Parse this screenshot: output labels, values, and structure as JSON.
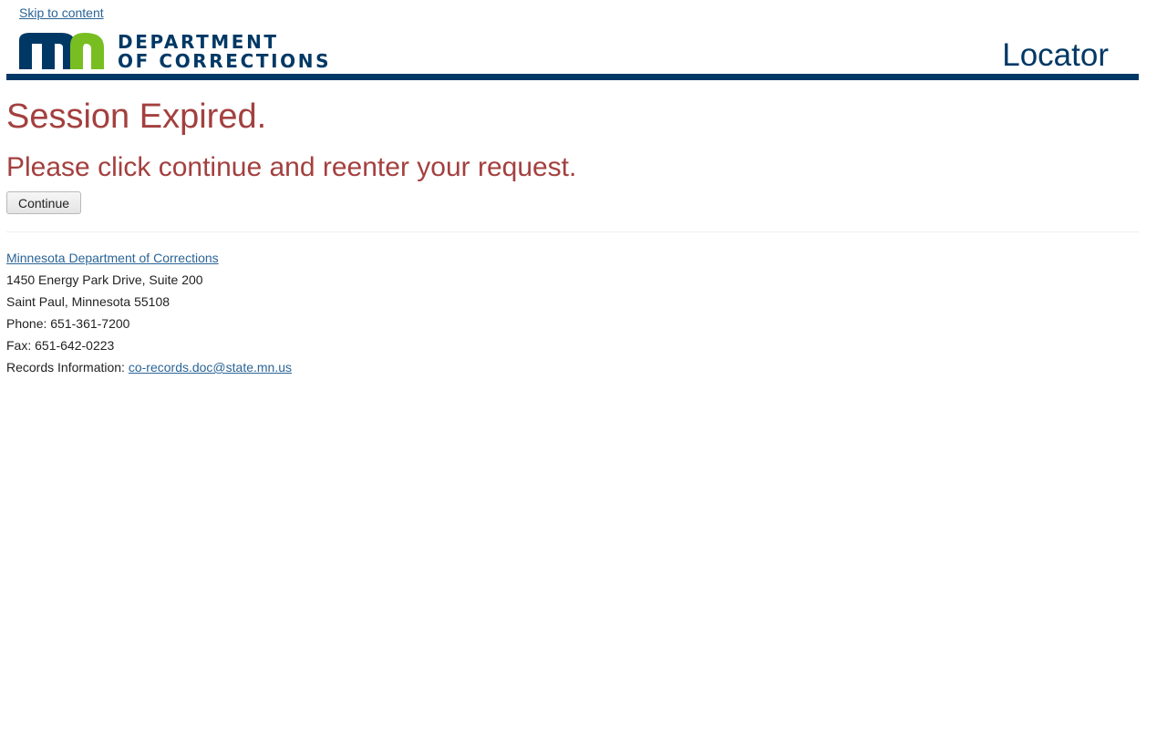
{
  "skip_link": "Skip to content",
  "header": {
    "logo_alt": "mn",
    "logo_line1": "DEPARTMENT",
    "logo_line2": "OF CORRECTIONS",
    "title": "Locator",
    "brand_blue": "#003865",
    "brand_green": "#78be21"
  },
  "main": {
    "title": "Session Expired.",
    "message": "Please click continue and reenter your request.",
    "continue_label": "Continue",
    "accent_red": "#a3403f"
  },
  "footer": {
    "org_link": "Minnesota Department of Corrections",
    "address1": "1450 Energy Park Drive, Suite 200",
    "address2": "Saint Paul, Minnesota 55108",
    "phone": "Phone: 651-361-7200",
    "fax": "Fax: 651-642-0223",
    "records_label": "Records Information: ",
    "records_email": "co-records.doc@state.mn.us"
  }
}
